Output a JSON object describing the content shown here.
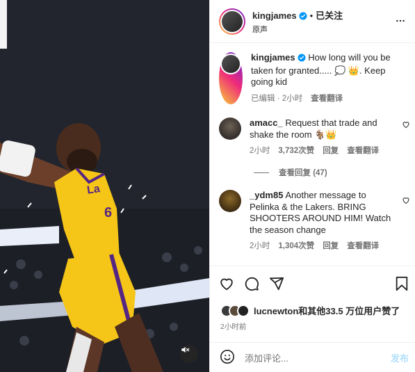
{
  "post": {
    "author": "kingjames",
    "follow_label": "已关注",
    "separator": "•",
    "audio_label": "原声"
  },
  "caption": {
    "author": "kingjames",
    "text": "How long will you be taken for granted..... 💭 👑. Keep going kid",
    "edited": "已编辑",
    "time": "2小时",
    "translate": "查看翻译"
  },
  "comments": [
    {
      "author": "amacc_",
      "text": "Request that trade and shake the room 🐐👑",
      "time": "2小时",
      "likes": "3,732次赞",
      "reply": "回复",
      "translate": "查看翻译"
    },
    {
      "author": "_ydm85",
      "text": "Another message to Pelinka & the Lakers. BRING SHOOTERS AROUND HIM! Watch the season change",
      "time": "2小时",
      "likes": "1,304次赞",
      "reply": "回复",
      "translate": "查看翻译"
    }
  ],
  "view_replies": "查看回复 (47)",
  "likes_summary": {
    "user": "lucnewton",
    "rest": "和其他33.5 万位用户赞了"
  },
  "post_time": "2小时前",
  "add_comment": {
    "placeholder": "添加评论...",
    "post_label": "发布"
  },
  "icons": {
    "more": "more-horizontal-icon",
    "heart": "heart-icon",
    "comment": "comment-icon",
    "share": "share-icon",
    "bookmark": "bookmark-icon",
    "emoji": "emoji-icon",
    "mute": "muted-speaker-icon",
    "verified": "verified-badge-icon"
  },
  "colors": {
    "verified": "#0095f6",
    "jersey": "#f5c518",
    "shorts_trim": "#552583",
    "post_button_disabled": "#b2dffc"
  }
}
